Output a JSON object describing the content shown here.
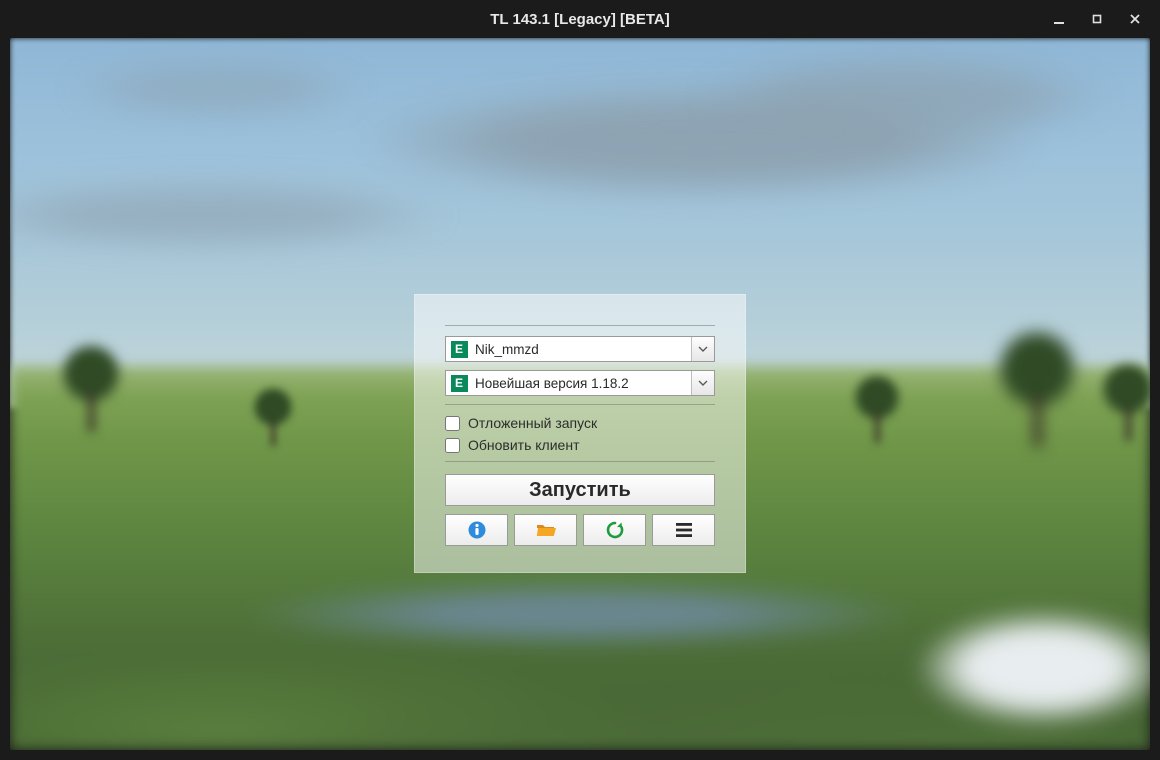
{
  "window": {
    "title": "TL 143.1 [Legacy] [BETA]"
  },
  "panel": {
    "account": {
      "badge": "E",
      "value": "Nik_mmzd"
    },
    "version": {
      "badge": "E",
      "value": "Новейшая версия 1.18.2"
    },
    "delayed_launch_label": "Отложенный запуск",
    "update_client_label": "Обновить клиент",
    "launch_label": "Запустить"
  },
  "icons": {
    "info": "info-icon",
    "folder": "folder-icon",
    "refresh": "refresh-icon",
    "menu": "menu-icon"
  }
}
